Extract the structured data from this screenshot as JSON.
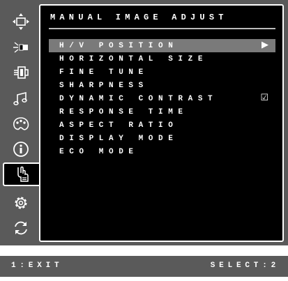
{
  "menu": {
    "title": "MANUAL IMAGE ADJUST",
    "items": [
      {
        "label": "H/V POSITION",
        "indicator": "▶"
      },
      {
        "label": "HORIZONTAL SIZE",
        "indicator": ""
      },
      {
        "label": "FINE TUNE",
        "indicator": ""
      },
      {
        "label": "SHARPNESS",
        "indicator": ""
      },
      {
        "label": "DYNAMIC CONTRAST",
        "indicator": "☑"
      },
      {
        "label": "RESPONSE TIME",
        "indicator": ""
      },
      {
        "label": "ASPECT RATIO",
        "indicator": ""
      },
      {
        "label": "DISPLAY MODE",
        "indicator": ""
      },
      {
        "label": "ECO MODE",
        "indicator": ""
      }
    ]
  },
  "sidebar": {
    "icons": [
      "auto-adjust-icon",
      "brightness-icon",
      "input-select-icon",
      "audio-icon",
      "color-icon",
      "information-icon",
      "manual-adjust-icon",
      "setup-icon",
      "recall-icon"
    ],
    "selected": "manual-adjust-icon"
  },
  "footer": {
    "exit_hint": "1:EXIT",
    "select_hint": "SELECT:2"
  },
  "colors": {
    "frame": "#5a5a5a",
    "panel": "#000000",
    "highlight": "#7a7a7a",
    "text": "#ffffff"
  }
}
